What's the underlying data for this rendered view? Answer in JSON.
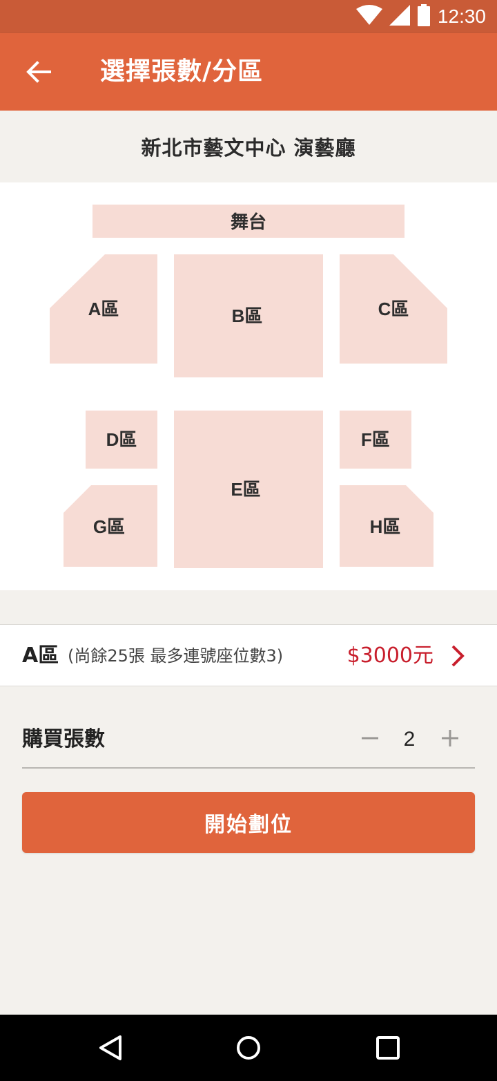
{
  "status_bar": {
    "time": "12:30",
    "icons": [
      "wifi-icon",
      "signal-icon",
      "battery-icon"
    ]
  },
  "app_bar": {
    "title": "選擇張數/分區",
    "back_icon": "arrow-left-icon"
  },
  "venue": {
    "name": "新北市藝文中心 演藝廳"
  },
  "seat_map": {
    "stage_label": "舞台",
    "zones": {
      "a": "A區",
      "b": "B區",
      "c": "C區",
      "d": "D區",
      "e": "E區",
      "f": "F區",
      "g": "G區",
      "h": "H區"
    }
  },
  "selected_zone": {
    "name": "A區",
    "remaining_text": "(尚餘25張 最多連號座位數3)",
    "price": "$3000元",
    "chevron_icon": "chevron-right-icon"
  },
  "quantity": {
    "label": "購買張數",
    "value": "2",
    "minus_icon": "minus-icon",
    "plus_icon": "plus-icon"
  },
  "action": {
    "label": "開始劃位"
  },
  "nav_bar": {
    "icons": [
      "back-triangle-icon",
      "home-circle-icon",
      "recents-square-icon"
    ]
  },
  "colors": {
    "status_bar": "#c95b37",
    "app_bar": "#e0643c",
    "zone_fill": "#f7dcd5",
    "price": "#c81e2c",
    "background": "#f3f1ed"
  }
}
